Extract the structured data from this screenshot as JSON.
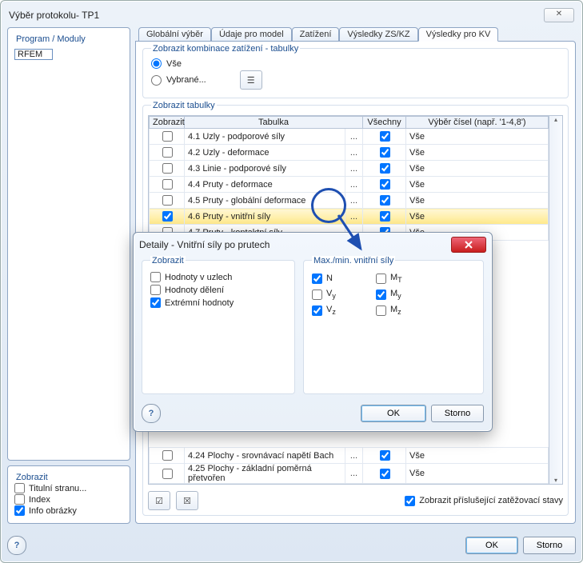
{
  "window": {
    "title": "Výběr protokolu- TP1"
  },
  "left": {
    "programModuly": "Program / Moduly",
    "module": "RFEM",
    "zobrazit": "Zobrazit",
    "titulni": "Titulní stranu...",
    "titulni_checked": false,
    "index": "Index",
    "index_checked": false,
    "info": "Info obrázky",
    "info_checked": true
  },
  "tabs": {
    "items": [
      {
        "label": "Globální výběr",
        "active": false
      },
      {
        "label": "Údaje pro model",
        "active": false
      },
      {
        "label": "Zatížení",
        "active": false
      },
      {
        "label": "Výsledky ZS/KZ",
        "active": false
      },
      {
        "label": "Výsledky pro KV",
        "active": true
      }
    ]
  },
  "sectionCombos": {
    "title": "Zobrazit kombinace zatížení - tabulky",
    "vse": "Vše",
    "vybrane": "Vybrané..."
  },
  "sectionTables": {
    "title": "Zobrazit tabulky",
    "cols": {
      "zobrazit": "Zobrazit",
      "tabulka": "Tabulka",
      "vsechny": "Všechny",
      "vyber": "Výběr čísel (např. '1-4,8')"
    },
    "rows": [
      {
        "show": false,
        "name": "4.1 Uzly - podporové síly",
        "all": true,
        "sel": "Vše"
      },
      {
        "show": false,
        "name": "4.2 Uzly - deformace",
        "all": true,
        "sel": "Vše"
      },
      {
        "show": false,
        "name": "4.3 Linie - podporové síly",
        "all": true,
        "sel": "Vše"
      },
      {
        "show": false,
        "name": "4.4 Pruty - deformace",
        "all": true,
        "sel": "Vše"
      },
      {
        "show": false,
        "name": "4.5 Pruty - globální deformace",
        "all": true,
        "sel": "Vše"
      },
      {
        "show": true,
        "name": "4.6 Pruty - vnitřní síly",
        "all": true,
        "sel": "Vše",
        "hl": true
      },
      {
        "show": false,
        "name": "4.7 Pruty - kontaktní síly",
        "all": true,
        "sel": "Vše"
      }
    ],
    "tailRows": [
      {
        "show": false,
        "name": "4.24 Plochy - srovnávací napětí Bach",
        "all": true,
        "sel": "Vše"
      },
      {
        "show": false,
        "name": "4.25 Plochy - základní poměrná přetvořen",
        "all": true,
        "sel": "Vše"
      }
    ]
  },
  "showLoadCases": "Zobrazit příslušející zatěžovací stavy",
  "showLoadCases_checked": true,
  "buttons": {
    "ok": "OK",
    "storno": "Storno"
  },
  "modal": {
    "title": "Detaily - Vnitřní síly po prutech",
    "zobrazit": "Zobrazit",
    "hodnotyUzlech": "Hodnoty v uzlech",
    "hodnotyUzlech_c": false,
    "hodnotyDeleni": "Hodnoty dělení",
    "hodnotyDeleni_c": false,
    "extremni": "Extrémní hodnoty",
    "extremni_c": true,
    "maxmin": "Max./min. vnitřní síly",
    "N": "N",
    "N_c": true,
    "Vy": "V",
    "Vy_sub": "y",
    "Vy_c": false,
    "Vz": "V",
    "Vz_sub": "z",
    "Vz_c": true,
    "MT": "M",
    "MT_sub": "T",
    "MT_c": false,
    "My": "M",
    "My_sub": "y",
    "My_c": true,
    "Mz": "M",
    "Mz_sub": "z",
    "Mz_c": false,
    "ok": "OK",
    "storno": "Storno"
  }
}
